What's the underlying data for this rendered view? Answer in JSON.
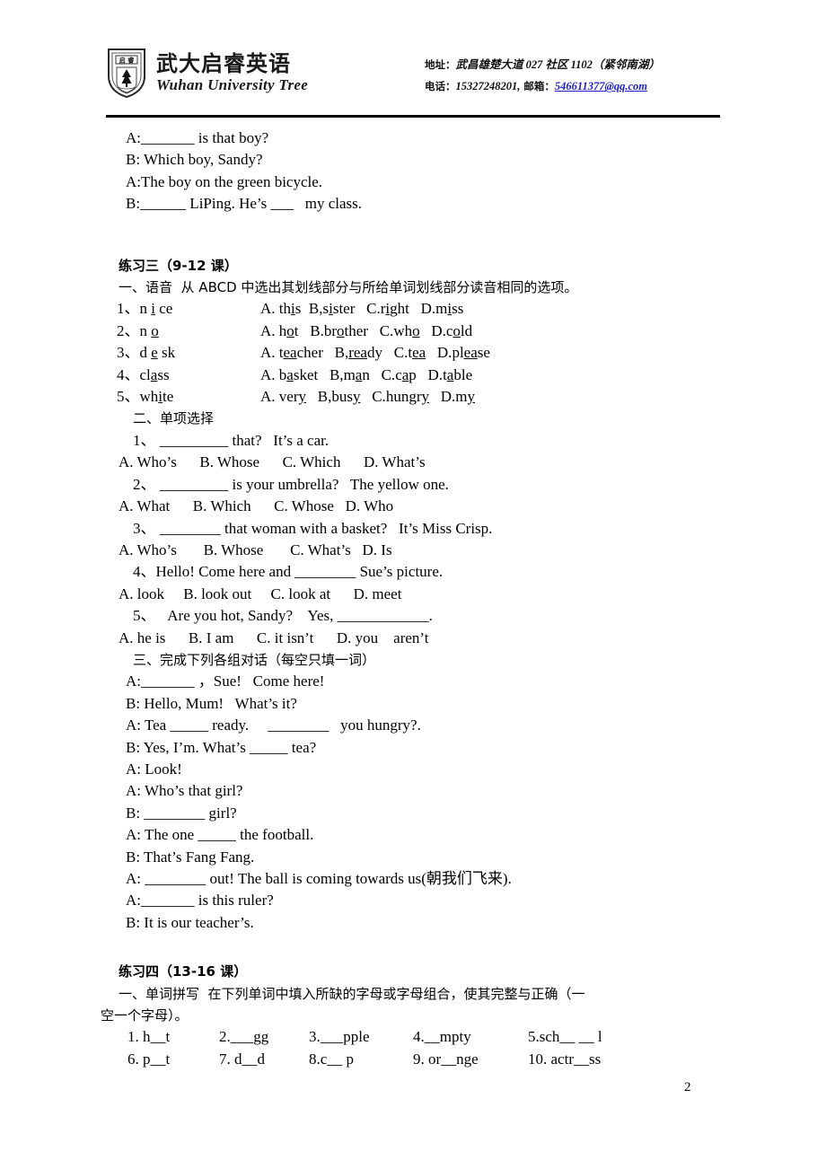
{
  "header": {
    "logo_icon": "shield-crest-tree-logo",
    "crest_chars": "启 睿",
    "brand_cn": "武大启睿英语",
    "brand_en": "Wuhan University Tree",
    "address_label": "地址：",
    "address_value": "武昌雄楚大道 027 社区 1102（紧邻南湖）",
    "phone_label": "电话：",
    "phone_value": "15327248201,",
    "email_label": "邮箱：",
    "email_value": "546611377@qq.com"
  },
  "top_dialogue": {
    "lines": [
      "A:_______ is that boy?",
      "B: Which boy, Sandy?",
      "A:The boy on the green bicycle.",
      "B:______ LiPing. He’s ___   my class."
    ]
  },
  "exercise3": {
    "title": "练习三（9-12 课）",
    "section1_title": "一、语音  从 ABCD 中选出其划线部分与所给单词划线部分读音相同的选项。",
    "phonetics": [
      {
        "num": "1、",
        "word_pre": "n ",
        "word_u": "i",
        "word_post": " ce",
        "opts": "A. th̲i̲s  B,s̲i̲ster   C.r̲i̲ght   D.m̲i̲ss",
        "choices": [
          {
            "label": "A.",
            "pre": " th",
            "u": "i",
            "post": "s"
          },
          {
            "label": "B,",
            "pre": "s",
            "u": "i",
            "post": "ster"
          },
          {
            "label": "C.",
            "pre": "r",
            "u": "i",
            "post": "ght"
          },
          {
            "label": "D.",
            "pre": "m",
            "u": "i",
            "post": "ss"
          }
        ]
      },
      {
        "num": "2、",
        "word_pre": "n ",
        "word_u": "o",
        "word_post": "",
        "choices": [
          {
            "label": "A.",
            "pre": " h",
            "u": "o",
            "post": "t"
          },
          {
            "label": "B.",
            "pre": "br",
            "u": "o",
            "post": "ther"
          },
          {
            "label": "C.",
            "pre": "wh",
            "u": "o",
            "post": ""
          },
          {
            "label": "D.",
            "pre": "c",
            "u": "o",
            "post": "ld"
          }
        ]
      },
      {
        "num": "3、",
        "word_pre": "d ",
        "word_u": "e",
        "word_post": " sk",
        "choices": [
          {
            "label": "A.",
            "pre": " t",
            "u": "ea",
            "post": "cher"
          },
          {
            "label": "B,",
            "pre": "",
            "u": "rea",
            "post": "dy"
          },
          {
            "label": "C.",
            "pre": "t",
            "u": "ea",
            "post": ""
          },
          {
            "label": "D.",
            "pre": "pl",
            "u": "ea",
            "post": "se"
          }
        ]
      },
      {
        "num": "4、",
        "word_pre": "cl",
        "word_u": "a",
        "word_post": "ss",
        "choices": [
          {
            "label": "A.",
            "pre": " b",
            "u": "a",
            "post": "sket"
          },
          {
            "label": "B,",
            "pre": "m",
            "u": "a",
            "post": "n"
          },
          {
            "label": "C.",
            "pre": "c",
            "u": "a",
            "post": "p"
          },
          {
            "label": "D.",
            "pre": "t",
            "u": "a",
            "post": "ble"
          }
        ]
      },
      {
        "num": "5、",
        "word_pre": "wh",
        "word_u": "i",
        "word_post": "te",
        "choices": [
          {
            "label": "A.",
            "pre": " ver",
            "u": "y",
            "post": ""
          },
          {
            "label": "B,",
            "pre": "bus",
            "u": "y",
            "post": ""
          },
          {
            "label": "C.",
            "pre": "hungr",
            "u": "y",
            "post": ""
          },
          {
            "label": "D.",
            "pre": "m",
            "u": "y",
            "post": ""
          }
        ]
      }
    ],
    "section2_title": "二、单项选择",
    "mcq": [
      {
        "stem": "1、 _________ that?   It’s a car.",
        "options": "A. Who’s      B. Whose      C. Which      D. What’s"
      },
      {
        "stem": "2、 _________ is your umbrella?   The yellow one.",
        "options": "A. What      B. Which      C. Whose   D. Who"
      },
      {
        "stem": "3、 ________ that woman with a basket?   It’s Miss Crisp.",
        "options": "A. Who’s       B. Whose       C. What’s   D. Is"
      },
      {
        "stem": "4、Hello! Come here and ________ Sue’s picture.",
        "options": "A. look     B. look out     C. look at      D. meet"
      },
      {
        "stem": "5、   Are you hot, Sandy?    Yes, ____________.",
        "options": "A. he is      B. I am      C. it isn’t      D. you    aren’t"
      }
    ],
    "section3_title": "三、完成下列各组对话（每空只填一词）",
    "dialogue": [
      "A:_______ ，Sue!   Come here!",
      "B: Hello, Mum!   What’s it?",
      "A: Tea _____ ready.     ________   you hungry?.",
      "B: Yes, I’m. What’s _____ tea?",
      "A: Look!",
      "A: Who’s that girl?",
      "B: ________ girl?",
      "A: The one _____ the football.",
      "B: That’s Fang Fang.",
      "A: ________ out! The ball is coming towards us(朝我们飞来).",
      "A:_______ is this ruler?",
      "B: It is our teacher’s."
    ]
  },
  "exercise4": {
    "title": "练习四（13-16 课）",
    "section1_title": "一、单词拼写  在下列单词中填入所缺的字母或字母组合，使其完整与正确（一",
    "section1_title_cont": "空一个字母）。",
    "spelling_row1": [
      "1. h__t",
      "2.___gg",
      "3.___pple",
      "4.__mpty",
      "5.sch__ __ l"
    ],
    "spelling_row2": [
      "6. p__t",
      "7. d__d",
      "8.c__ p",
      "9. or__nge",
      "10. actr__ss"
    ]
  },
  "footer": {
    "page_number": "2"
  }
}
